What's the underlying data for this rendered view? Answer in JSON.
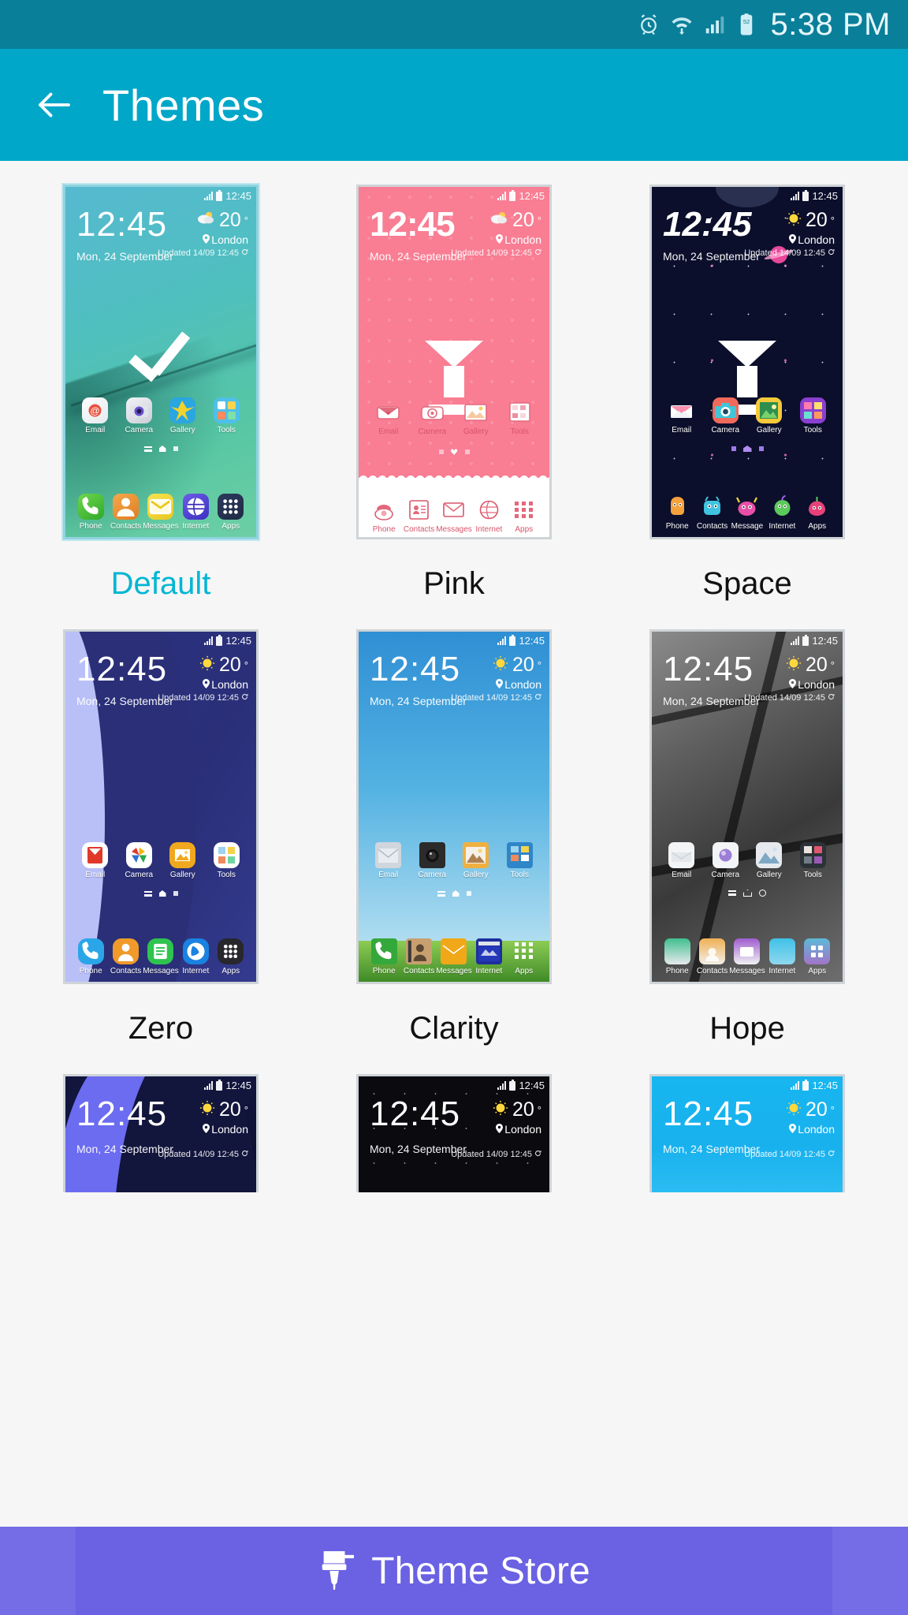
{
  "status_bar": {
    "time": "5:38 PM",
    "battery_level": "52",
    "icons": [
      "alarm-icon",
      "wifi-icon",
      "signal-icon",
      "battery-icon"
    ],
    "background_color": "#0a7f99"
  },
  "app_bar": {
    "title": "Themes",
    "back_label": "Back",
    "background_color": "#00a7c8"
  },
  "phone_preview": {
    "clock": "12:45",
    "date": "Mon, 24 September",
    "status_time": "12:45",
    "weather": {
      "temperature": "20",
      "degree": "°",
      "city": "London",
      "updated": "Updated 14/09 12:45",
      "pin_icon": "location-pin-icon",
      "refresh_icon": "refresh-icon"
    },
    "apps_row": [
      "Email",
      "Camera",
      "Gallery",
      "Tools"
    ],
    "dock_row": [
      "Phone",
      "Contacts",
      "Messages",
      "Internet",
      "Apps"
    ],
    "dock_row_space": [
      "Phone",
      "Contacts",
      "Message",
      "Internet",
      "Apps"
    ]
  },
  "themes": [
    {
      "name": "Default",
      "selected": true,
      "downloadable": false,
      "accent": "#00b6d4"
    },
    {
      "name": "Pink",
      "selected": false,
      "downloadable": true,
      "accent": "#f97d93"
    },
    {
      "name": "Space",
      "selected": false,
      "downloadable": true,
      "accent": "#0b0f2b"
    },
    {
      "name": "Zero",
      "selected": false,
      "downloadable": false,
      "accent": "#2a2f78"
    },
    {
      "name": "Clarity",
      "selected": false,
      "downloadable": false,
      "accent": "#54b2e2"
    },
    {
      "name": "Hope",
      "selected": false,
      "downloadable": false,
      "accent": "#5f5f5f"
    },
    {
      "name": "",
      "selected": false,
      "downloadable": false,
      "accent": "#171b4a"
    },
    {
      "name": "",
      "selected": false,
      "downloadable": false,
      "accent": "#0a0a0f"
    },
    {
      "name": "",
      "selected": false,
      "downloadable": false,
      "accent": "#17b6f0"
    }
  ],
  "bottom_bar": {
    "label": "Theme Store",
    "icon": "paint-brush-icon",
    "background_color": "#6a62e3"
  }
}
